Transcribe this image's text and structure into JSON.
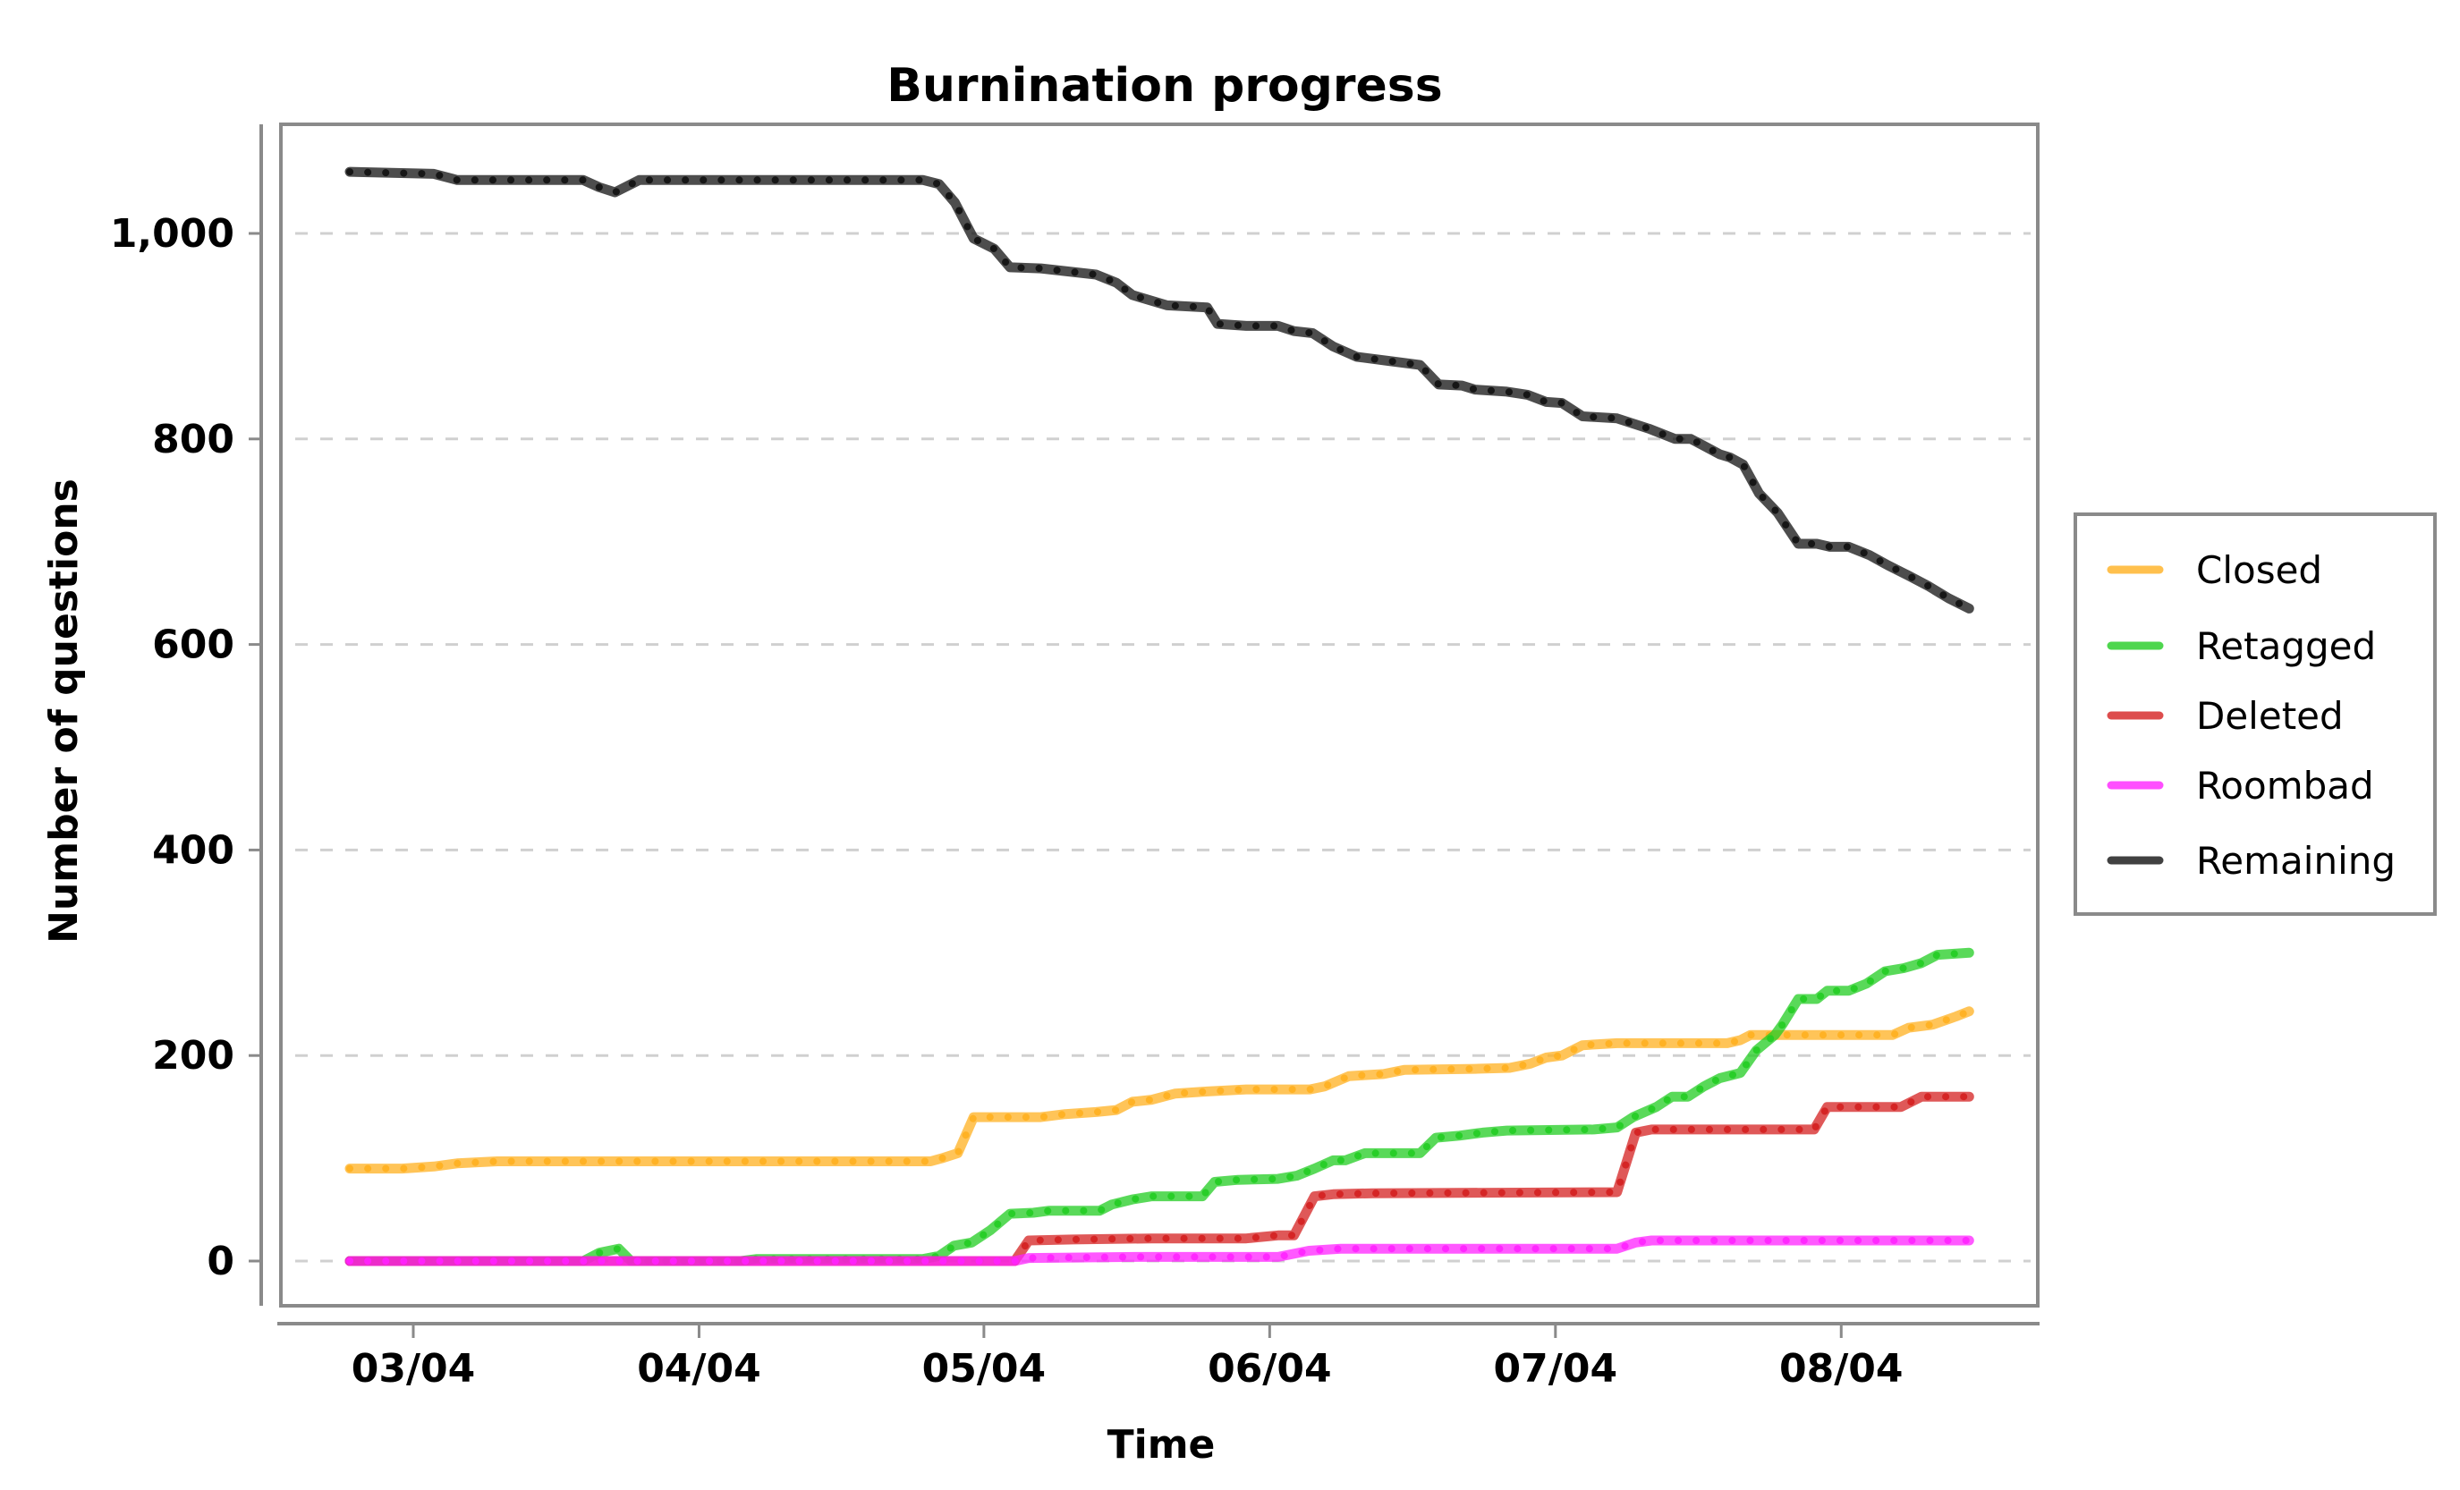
{
  "chart_data": {
    "type": "line",
    "title": "Burnination progress",
    "xlabel": "Time",
    "ylabel": "Number of questions",
    "x_unit": "days since 03/04",
    "xlim": [
      -9,
      170
    ],
    "ylim": [
      -40,
      1110
    ],
    "grid": true,
    "legend_position": "right",
    "x_ticks": [
      {
        "label": "03/04",
        "value": 0
      },
      {
        "label": "04/04",
        "value": 30.6
      },
      {
        "label": "05/04",
        "value": 61.1
      },
      {
        "label": "06/04",
        "value": 91.7
      },
      {
        "label": "07/04",
        "value": 122.3
      },
      {
        "label": "08/04",
        "value": 152.9
      }
    ],
    "y_ticks": [
      {
        "label": "0",
        "value": 0
      },
      {
        "label": "200",
        "value": 200
      },
      {
        "label": "400",
        "value": 400
      },
      {
        "label": "600",
        "value": 600
      },
      {
        "label": "800",
        "value": 800
      },
      {
        "label": "1,000",
        "value": 1000
      }
    ],
    "series": [
      {
        "name": "Closed",
        "color": "#ffb020",
        "points": [
          [
            -6.8,
            90
          ],
          [
            -1.2,
            90
          ],
          [
            2.2,
            92
          ],
          [
            4.7,
            95
          ],
          [
            9,
            97
          ],
          [
            55.4,
            97
          ],
          [
            56.6,
            100
          ],
          [
            58.3,
            105
          ],
          [
            60,
            140
          ],
          [
            67.2,
            140
          ],
          [
            69.8,
            143
          ],
          [
            73.1,
            145
          ],
          [
            75.3,
            147
          ],
          [
            77,
            155
          ],
          [
            79.1,
            157
          ],
          [
            81.6,
            163
          ],
          [
            85,
            165
          ],
          [
            89.2,
            167
          ],
          [
            96,
            167
          ],
          [
            97.6,
            170
          ],
          [
            100.2,
            180
          ],
          [
            103.9,
            182
          ],
          [
            106.1,
            186
          ],
          [
            113.7,
            187
          ],
          [
            117.4,
            188
          ],
          [
            119.6,
            192
          ],
          [
            121.3,
            198
          ],
          [
            123,
            200
          ],
          [
            125.2,
            210
          ],
          [
            128.9,
            212
          ],
          [
            140.7,
            212
          ],
          [
            142.1,
            215
          ],
          [
            143.2,
            220
          ],
          [
            158.4,
            220
          ],
          [
            160.1,
            227
          ],
          [
            162.7,
            230
          ],
          [
            165.2,
            238
          ],
          [
            166.6,
            243
          ]
        ]
      },
      {
        "name": "Retagged",
        "color": "#22cc22",
        "points": [
          [
            -6.8,
            0
          ],
          [
            18.2,
            0
          ],
          [
            19.9,
            8
          ],
          [
            22,
            12
          ],
          [
            23.3,
            0
          ],
          [
            35.1,
            0
          ],
          [
            36.8,
            2
          ],
          [
            54.6,
            2
          ],
          [
            56.3,
            5
          ],
          [
            57.9,
            15
          ],
          [
            59.8,
            18
          ],
          [
            61.8,
            30
          ],
          [
            63.9,
            46
          ],
          [
            66.4,
            47
          ],
          [
            68.1,
            49
          ],
          [
            73.5,
            49
          ],
          [
            74.8,
            55
          ],
          [
            77,
            60
          ],
          [
            79.1,
            63
          ],
          [
            84.5,
            63
          ],
          [
            85.8,
            77
          ],
          [
            88.3,
            79
          ],
          [
            92.6,
            80
          ],
          [
            94.6,
            83
          ],
          [
            96.5,
            90
          ],
          [
            98.5,
            98
          ],
          [
            99.8,
            98
          ],
          [
            101.9,
            105
          ],
          [
            107.8,
            105
          ],
          [
            109.5,
            120
          ],
          [
            112,
            122
          ],
          [
            114.5,
            125
          ],
          [
            117.1,
            127
          ],
          [
            126.4,
            128
          ],
          [
            128.9,
            130
          ],
          [
            130.6,
            140
          ],
          [
            133.1,
            150
          ],
          [
            134.8,
            160
          ],
          [
            136.5,
            160
          ],
          [
            138.2,
            170
          ],
          [
            139.9,
            178
          ],
          [
            142.1,
            183
          ],
          [
            143.8,
            205
          ],
          [
            145.8,
            220
          ],
          [
            146.6,
            230
          ],
          [
            148.3,
            255
          ],
          [
            150.3,
            255
          ],
          [
            151.4,
            263
          ],
          [
            153.7,
            263
          ],
          [
            155.6,
            270
          ],
          [
            157.6,
            282
          ],
          [
            159.6,
            285
          ],
          [
            161.5,
            290
          ],
          [
            163.2,
            298
          ],
          [
            166.6,
            300
          ]
        ]
      },
      {
        "name": "Deleted",
        "color": "#d42020",
        "points": [
          [
            -6.8,
            0
          ],
          [
            64.4,
            0
          ],
          [
            65.9,
            20
          ],
          [
            70.6,
            21
          ],
          [
            79.1,
            22
          ],
          [
            89.2,
            22
          ],
          [
            92.6,
            25
          ],
          [
            94.3,
            25
          ],
          [
            96.5,
            63
          ],
          [
            98.5,
            65
          ],
          [
            102.7,
            66
          ],
          [
            128.9,
            67
          ],
          [
            130.9,
            125
          ],
          [
            132.6,
            128
          ],
          [
            150,
            128
          ],
          [
            151.4,
            150
          ],
          [
            159.3,
            150
          ],
          [
            161.5,
            160
          ],
          [
            166.6,
            160
          ]
        ]
      },
      {
        "name": "Roombad",
        "color": "#ff22ff",
        "points": [
          [
            -6.8,
            0
          ],
          [
            64.4,
            0
          ],
          [
            65.9,
            3
          ],
          [
            77.4,
            4
          ],
          [
            92.6,
            4
          ],
          [
            95.9,
            10
          ],
          [
            99.3,
            12
          ],
          [
            128.9,
            12
          ],
          [
            130.9,
            18
          ],
          [
            132.6,
            20
          ],
          [
            166.6,
            20
          ]
        ]
      },
      {
        "name": "Remaining",
        "color": "#111111",
        "points": [
          [
            -6.8,
            1060
          ],
          [
            2.2,
            1058
          ],
          [
            4.7,
            1052
          ],
          [
            18.2,
            1052
          ],
          [
            19.9,
            1045
          ],
          [
            21.6,
            1040
          ],
          [
            24.2,
            1052
          ],
          [
            54.6,
            1052
          ],
          [
            56.3,
            1048
          ],
          [
            58,
            1030
          ],
          [
            60,
            995
          ],
          [
            62.2,
            985
          ],
          [
            63.9,
            967
          ],
          [
            67.2,
            966
          ],
          [
            73.1,
            960
          ],
          [
            75.3,
            952
          ],
          [
            77,
            940
          ],
          [
            80.7,
            930
          ],
          [
            85,
            928
          ],
          [
            86.1,
            912
          ],
          [
            89.2,
            910
          ],
          [
            92.6,
            910
          ],
          [
            94.3,
            905
          ],
          [
            96.3,
            903
          ],
          [
            98.5,
            890
          ],
          [
            101,
            880
          ],
          [
            104.4,
            876
          ],
          [
            107.8,
            872
          ],
          [
            109.8,
            853
          ],
          [
            112.3,
            852
          ],
          [
            113.7,
            848
          ],
          [
            117.1,
            846
          ],
          [
            119.3,
            843
          ],
          [
            121.3,
            836
          ],
          [
            123,
            835
          ],
          [
            125.2,
            822
          ],
          [
            128.9,
            820
          ],
          [
            132.3,
            810
          ],
          [
            135.1,
            800
          ],
          [
            136.8,
            800
          ],
          [
            139.9,
            785
          ],
          [
            141,
            782
          ],
          [
            142.4,
            775
          ],
          [
            144.1,
            747
          ],
          [
            146.1,
            728
          ],
          [
            148.3,
            698
          ],
          [
            150.3,
            698
          ],
          [
            151.7,
            695
          ],
          [
            153.7,
            695
          ],
          [
            155.9,
            687
          ],
          [
            157.9,
            677
          ],
          [
            160.1,
            667
          ],
          [
            162.2,
            657
          ],
          [
            164.4,
            645
          ],
          [
            166.6,
            635
          ]
        ]
      }
    ]
  }
}
